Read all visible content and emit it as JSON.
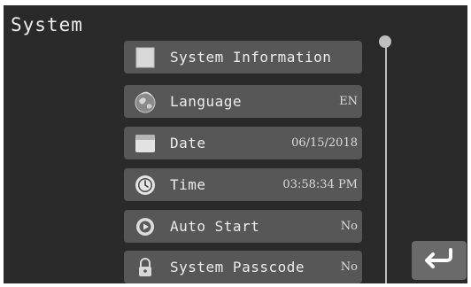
{
  "screen": {
    "title": "System"
  },
  "menu": [
    {
      "label": "System Information",
      "value": "",
      "icon": "info-square-icon"
    },
    {
      "label": "Language",
      "value": "EN",
      "icon": "globe-icon"
    },
    {
      "label": "Date",
      "value": "06/15/2018",
      "icon": "calendar-icon"
    },
    {
      "label": "Time",
      "value": "03:58:34 PM",
      "icon": "clock-icon"
    },
    {
      "label": "Auto Start",
      "value": "No",
      "icon": "play-icon"
    },
    {
      "label": "System Passcode",
      "value": "No",
      "icon": "lock-icon"
    }
  ],
  "scroll_position": 0,
  "back_button": {
    "icon": "return-arrow-icon"
  },
  "colors": {
    "background": "#2a2a2a",
    "item": "#575757",
    "text": "#ececec"
  }
}
